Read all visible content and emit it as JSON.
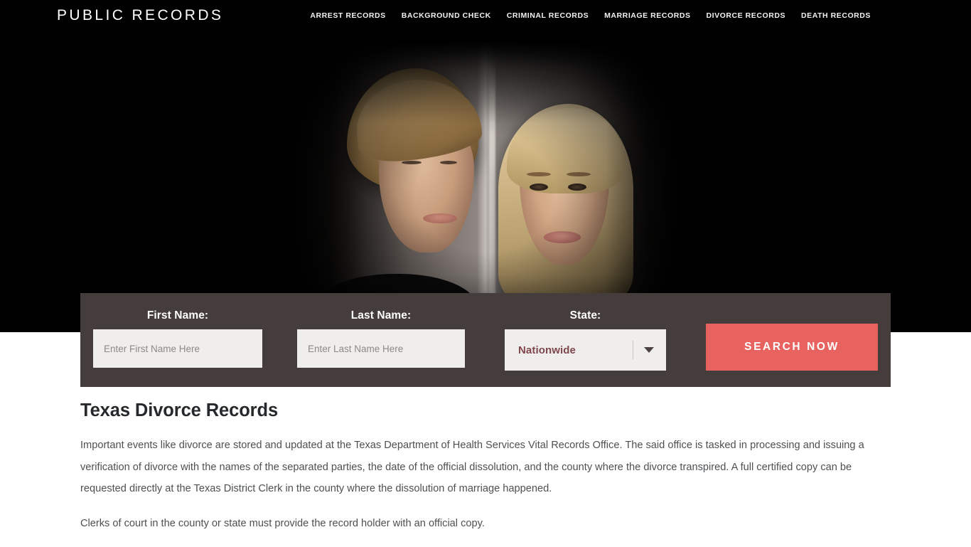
{
  "header": {
    "brand": "PUBLIC RECORDS",
    "nav": [
      {
        "label": "ARREST RECORDS",
        "name": "nav-arrest-records"
      },
      {
        "label": "BACKGROUND CHECK",
        "name": "nav-background-check"
      },
      {
        "label": "CRIMINAL RECORDS",
        "name": "nav-criminal-records"
      },
      {
        "label": "MARRIAGE RECORDS",
        "name": "nav-marriage-records"
      },
      {
        "label": "DIVORCE RECORDS",
        "name": "nav-divorce-records"
      },
      {
        "label": "DEATH RECORDS",
        "name": "nav-death-records"
      }
    ]
  },
  "hero": {
    "image_alt": "Separated couple on opposite sides of a wall"
  },
  "search": {
    "first_name": {
      "label": "First Name:",
      "placeholder": "Enter First Name Here",
      "value": ""
    },
    "last_name": {
      "label": "Last Name:",
      "placeholder": "Enter Last Name Here",
      "value": ""
    },
    "state": {
      "label": "State:",
      "selected": "Nationwide",
      "caret_icon": "chevron-down-icon"
    },
    "submit_label": "SEARCH NOW"
  },
  "main": {
    "title": "Texas Divorce Records",
    "paragraphs": [
      "Important events like divorce are stored and updated at the Texas Department of Health Services Vital Records Office. The said office is tasked in processing and issuing a verification of divorce with the names of the separated parties, the date of the official dissolution, and the county where the divorce transpired. A full certified copy can be requested directly at the Texas District Clerk in the county where the dissolution of marriage happened.",
      "Clerks of court in the county or state must provide the record holder with an official copy."
    ]
  },
  "colors": {
    "header_bg": "#000000",
    "searchbar_bg": "#453d3b",
    "accent_red": "#e8635f",
    "input_bg": "#efeeec",
    "select_text": "#80474a",
    "title_text": "#26292b",
    "body_text": "#4d5052",
    "page_bg": "#ffffff"
  }
}
